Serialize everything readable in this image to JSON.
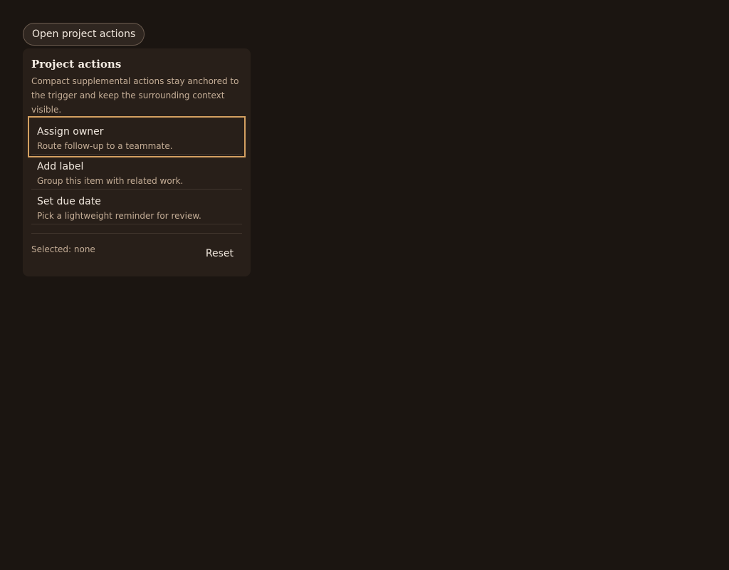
{
  "trigger": {
    "label": "Open project actions"
  },
  "panel": {
    "title": "Project actions",
    "description": "Compact supplemental actions stay anchored to the trigger and keep the surrounding context visible.",
    "items": [
      {
        "label": "Assign owner",
        "description": "Route follow-up to a teammate.",
        "focused": true
      },
      {
        "label": "Add label",
        "description": "Group this item with related work.",
        "focused": false
      },
      {
        "label": "Set due date",
        "description": "Pick a lightweight reminder for review.",
        "focused": false
      }
    ],
    "footer": {
      "selected_text": "Selected: none",
      "reset_label": "Reset"
    }
  },
  "colors": {
    "background": "#1b1511",
    "panel": "#281f19",
    "focus_ring": "#d4a061",
    "muted_text": "#c4ad96"
  }
}
